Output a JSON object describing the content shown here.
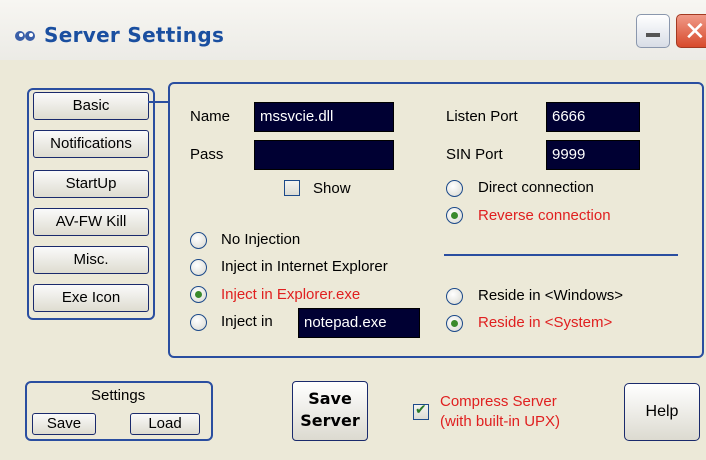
{
  "window": {
    "title": "Server Settings",
    "icon": "eyes-icon"
  },
  "sidebar": {
    "items": [
      {
        "label": "Basic"
      },
      {
        "label": "Notifications"
      },
      {
        "label": "StartUp"
      },
      {
        "label": "AV-FW Kill"
      },
      {
        "label": "Misc."
      },
      {
        "label": "Exe Icon"
      }
    ]
  },
  "basic": {
    "name_label": "Name",
    "name_value": "mssvcie.dll",
    "pass_label": "Pass",
    "pass_value": "",
    "show_label": "Show",
    "show_checked": false,
    "listen_port_label": "Listen Port",
    "listen_port_value": "6666",
    "sin_port_label": "SIN Port",
    "sin_port_value": "9999",
    "connection_options": [
      {
        "label": "Direct connection",
        "selected": false
      },
      {
        "label": "Reverse connection",
        "selected": true
      }
    ],
    "injection_options": [
      {
        "label": "No Injection",
        "selected": false
      },
      {
        "label": "Inject in Internet Explorer",
        "selected": false
      },
      {
        "label": "Inject in Explorer.exe",
        "selected": true
      },
      {
        "label": "Inject in",
        "selected": false
      }
    ],
    "inject_target_value": "notepad.exe",
    "reside_options": [
      {
        "label": "Reside in <Windows>",
        "selected": false
      },
      {
        "label": "Reside in <System>",
        "selected": true
      }
    ]
  },
  "footer": {
    "settings_group_label": "Settings",
    "save_label": "Save",
    "load_label": "Load",
    "save_server_line1": "Save",
    "save_server_line2": "Server",
    "compress_line1": "Compress Server",
    "compress_line2": "(with built-in UPX)",
    "compress_checked": true,
    "help_label": "Help"
  },
  "colors": {
    "accent": "#2a4ea0",
    "selected_text": "#e02020",
    "field_bg": "#000033",
    "window_bg": "#ece9d8"
  }
}
